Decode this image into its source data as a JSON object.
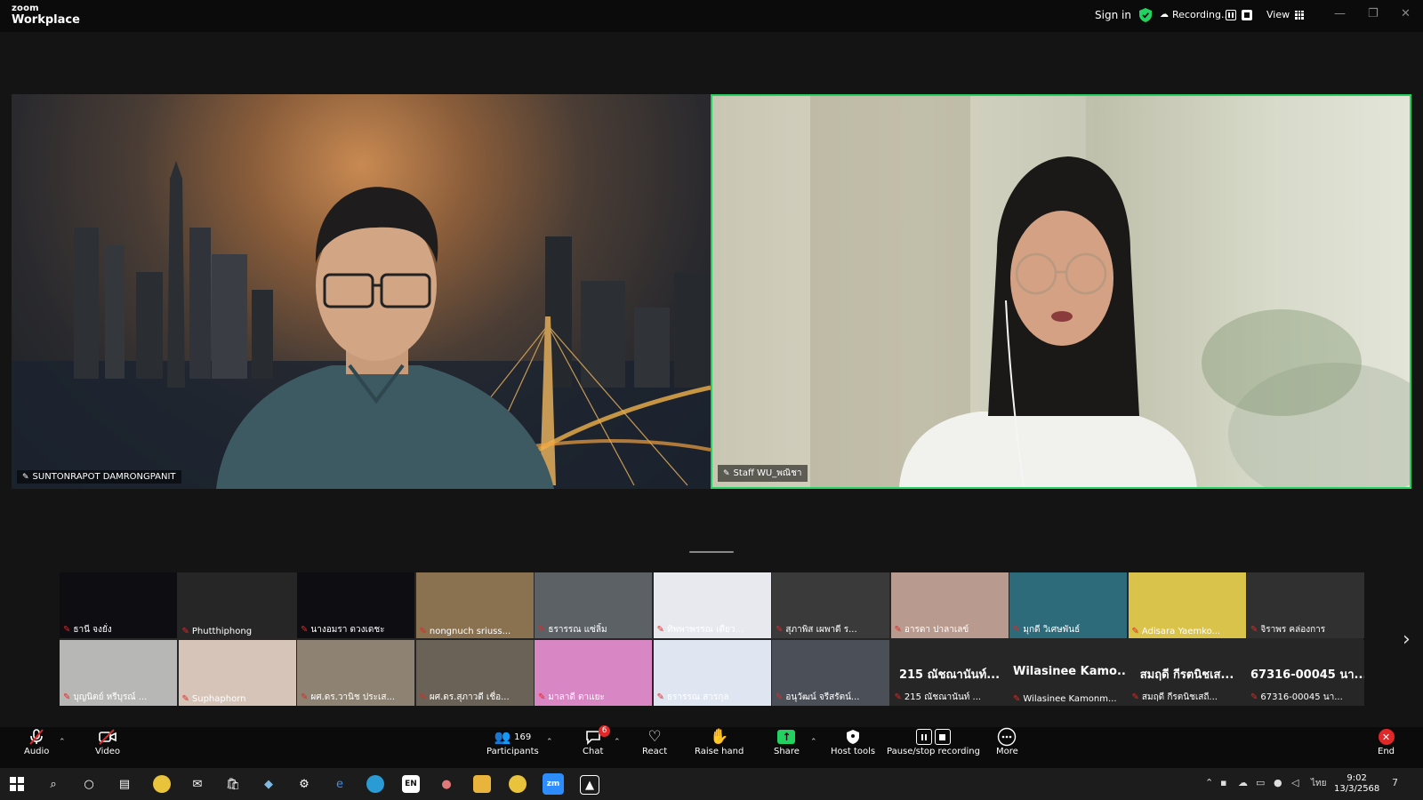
{
  "app": {
    "brand_top": "zoom",
    "brand_bottom": "Workplace"
  },
  "topbar": {
    "sign_in": "Sign in",
    "recording": "Recording...",
    "view": "View",
    "minimize": "—",
    "restore": "❐",
    "close": "✕"
  },
  "speakers": [
    {
      "name": "SUNTONRAPOT DAMRONGPANIT"
    },
    {
      "name": "Staff WU_พณิชา"
    }
  ],
  "gallery_row1": [
    {
      "name": "ธานี จงยั่ง",
      "bg": "#0d0d12"
    },
    {
      "name": "Phutthiphong",
      "bg": "#262626"
    },
    {
      "name": "นางอมรา ดวงเดชะ",
      "bg": "#0d0d12"
    },
    {
      "name": "nongnuch sriuss...",
      "bg": "#8a7150"
    },
    {
      "name": "ธรารรณ แซ่ลิ้ม",
      "bg": "#5c6166"
    },
    {
      "name": "ทิพพาพรรณ เดียว...",
      "bg": "#e7e9ee"
    },
    {
      "name": "สุภาพิส เผพาดี ร...",
      "bg": "#3a3a3a"
    },
    {
      "name": "อารดา ปาลาเลข์",
      "bg": "#b89a8e"
    },
    {
      "name": "มุกดี วิเศษพันธ์",
      "bg": "#2d6a7a"
    },
    {
      "name": "Adisara Yaemko...",
      "bg": "#d9c34a"
    },
    {
      "name": "จิราพร คล่องการ",
      "bg": "#303030"
    }
  ],
  "gallery_row2": [
    {
      "name": "บุญนิตย์ หรีบุรณ์ ...",
      "bg": "#b7b8b6",
      "big": ""
    },
    {
      "name": "Suphaphorn",
      "bg": "#d6c4b8",
      "big": ""
    },
    {
      "name": "ผศ.ดร.วานิช ประเส...",
      "bg": "#8e8372",
      "big": ""
    },
    {
      "name": "ผศ.ดร.สุภาวดี เชื่อ...",
      "bg": "#6a6256",
      "big": ""
    },
    {
      "name": "มาลาดี ตาแยะ",
      "bg": "#d986c4",
      "big": ""
    },
    {
      "name": "ธรารรณ สารกุล",
      "bg": "#dfe6f2",
      "big": ""
    },
    {
      "name": "อนุวัฒน์ จรีสรัตน์...",
      "bg": "#4b5058",
      "big": ""
    },
    {
      "name": "215 ณัชณานันท์ ...",
      "bg": "#262626",
      "big": "215 ณัชณานันท์..."
    },
    {
      "name": "Wilasinee Kamonm...",
      "bg": "#262626",
      "big": "Wilasinee Kamo..."
    },
    {
      "name": "สมฤดี กีรตนิชเสถี...",
      "bg": "#262626",
      "big": "สมฤดี กีรตนิชเส..."
    },
    {
      "name": "67316-00045 นา...",
      "bg": "#262626",
      "big": "67316-00045 นา..."
    }
  ],
  "toolbar": {
    "audio": "Audio",
    "video": "Video",
    "participants": "Participants",
    "participants_count": "169",
    "chat": "Chat",
    "chat_badge": "6",
    "react": "React",
    "raise_hand": "Raise hand",
    "share": "Share",
    "host_tools": "Host tools",
    "pause_stop": "Pause/stop recording",
    "more": "More",
    "end": "End"
  },
  "taskbar": {
    "clock_time": "9:02",
    "clock_date": "13/3/2568",
    "lang": "ไทย",
    "lang_badge": "EN",
    "notif_count": "7"
  },
  "colors": {
    "active_speaker": "#23d160",
    "muted": "#e02828",
    "end": "#e02828"
  }
}
